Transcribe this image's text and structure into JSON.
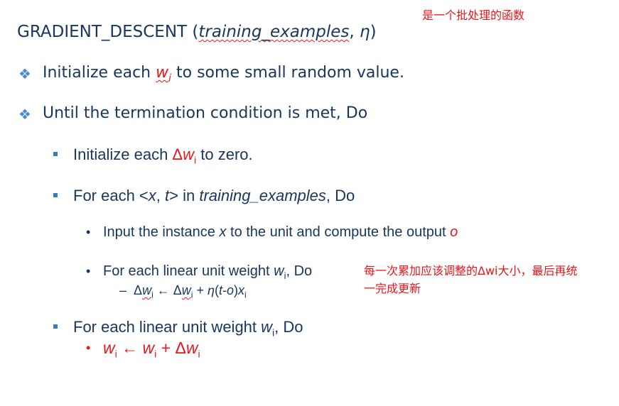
{
  "annotations": {
    "top_note": "是一个批处理的函数",
    "side_note_line1": "每一次累加应该调整的Δwi大小，最后再统",
    "side_note_line2": "一完成更新"
  },
  "title": {
    "name": "GRADIENT_DESCENT",
    "open": " (",
    "param1": "training_examples",
    "sep": ", ",
    "param2": "η",
    "close": ")"
  },
  "bullets": {
    "init": {
      "pre": "Initialize each ",
      "w": "w",
      "sub": "i",
      "post": " to some small random value."
    },
    "until": {
      "text": "Until the termination condition is met, Do"
    },
    "init_delta": {
      "pre": "Initialize each ",
      "delta": "Δ",
      "w": "w",
      "sub": "i",
      "post": " to zero."
    },
    "for_each_example": {
      "pre": "For each <",
      "x": "x",
      "comma": ", ",
      "t": "t",
      "mid": "> in ",
      "examples": "training_examples",
      "post": ", Do"
    },
    "input_instance": {
      "pre": "Input the instance ",
      "x": "x",
      "mid": " to the unit and compute the output ",
      "o": "o"
    },
    "for_each_weight": {
      "pre": "For each linear unit weight ",
      "w": "w",
      "sub": "i",
      "post": ", Do"
    },
    "delta_update": {
      "dash": "–",
      "delta1": "Δ",
      "w1": "w",
      "sub1": "i",
      "arrow": " ← ",
      "delta2": "Δ",
      "w2": "w",
      "sub2": "i",
      "plus": " + ",
      "eta": "η",
      "paren": "(",
      "t": "t",
      "minus": "-",
      "o": "o",
      "close": ")",
      "x": "x",
      "subx": "i"
    },
    "for_each_weight2": {
      "pre": "For each linear unit weight ",
      "w": "w",
      "sub": "i",
      "post": ", Do"
    },
    "weight_update": {
      "w1": "w",
      "sub1": "i",
      "arrow": " ← ",
      "w2": "w",
      "sub2": "i",
      "plus": " + ",
      "delta": "Δ",
      "w3": "w",
      "sub3": "i"
    }
  }
}
